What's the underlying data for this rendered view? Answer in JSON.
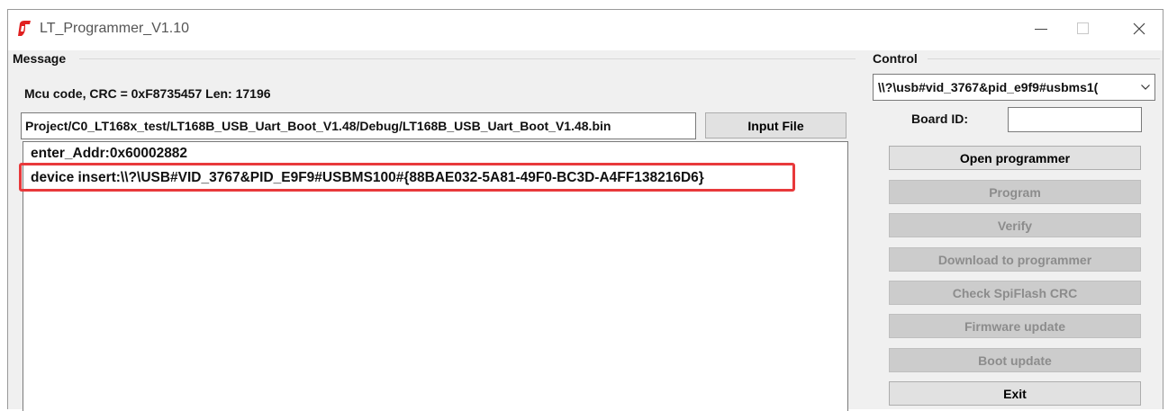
{
  "window": {
    "title": "LT_Programmer_V1.10",
    "controls": [
      "minimize",
      "maximize",
      "close"
    ]
  },
  "message": {
    "group_label": "Message",
    "mcu_code": "Mcu code, CRC = 0xF8735457 Len: 17196",
    "file_path": "Project/C0_LT168x_test/LT168B_USB_Uart_Boot_V1.48/Debug/LT168B_USB_Uart_Boot_V1.48.bin",
    "input_file_label": "Input File",
    "log": [
      "enter_Addr:0x60002882",
      "device insert:\\\\?\\USB#VID_3767&PID_E9F9#USBMS100#{88BAE032-5A81-49F0-BC3D-A4FF138216D6}"
    ]
  },
  "control": {
    "group_label": "Control",
    "device_select": "\\\\?\\usb#vid_3767&pid_e9f9#usbms1(",
    "board_id_label": "Board ID:",
    "board_id_value": "",
    "buttons": {
      "open_programmer": "Open programmer",
      "program": "Program",
      "verify": "Verify",
      "download": "Download to programmer",
      "check_crc": "Check SpiFlash CRC",
      "firmware_update": "Firmware update",
      "boot_update": "Boot update",
      "exit": "Exit"
    }
  },
  "colors": {
    "highlight": "#e8393b",
    "logo": "#e02020"
  }
}
